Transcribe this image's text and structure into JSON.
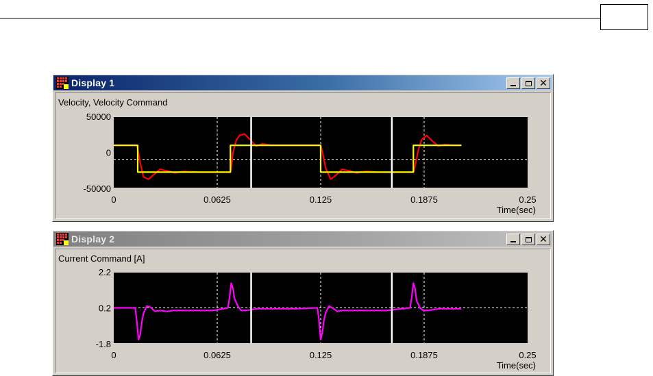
{
  "windows": [
    {
      "title": "Display 1",
      "active": true,
      "controls": {
        "minimize_icon": "minimize-icon",
        "maximize_icon": "maximize-icon",
        "close_icon": "close-icon"
      },
      "chart_data": {
        "type": "line",
        "title": "Velocity, Velocity Command",
        "xlabel": "Time(sec)",
        "ylabel": "",
        "xlim": [
          0,
          0.25
        ],
        "ylim": [
          -50000,
          50000
        ],
        "x_ticks": [
          "0",
          "0.0625",
          "0.125",
          "0.1875",
          "0.25"
        ],
        "y_ticks": [
          "50000",
          "0",
          "-50000"
        ],
        "y_tick_values": [
          50000,
          0,
          -50000
        ],
        "grid": true,
        "grid_values": {
          "x": [
            0.0625,
            0.125,
            0.1875
          ],
          "y": [
            -10000
          ]
        },
        "cursor_lines": [
          0.083,
          0.168
        ],
        "series": [
          {
            "color": "#ff0000",
            "x": [
              0,
              0.014,
              0.0145,
              0.016,
              0.018,
              0.021,
              0.024,
              0.028,
              0.032,
              0.037,
              0.042,
              0.05,
              0.06,
              0.0705,
              0.071,
              0.072,
              0.074,
              0.076,
              0.079,
              0.082,
              0.086,
              0.09,
              0.095,
              0.1,
              0.11,
              0.12,
              0.125,
              0.126,
              0.128,
              0.131,
              0.134,
              0.138,
              0.142,
              0.147,
              0.152,
              0.16,
              0.17,
              0.181,
              0.182,
              0.184,
              0.186,
              0.189,
              0.192,
              0.196,
              0.2,
              0.205,
              0.21
            ],
            "y": [
              10000,
              10000,
              5000,
              -15000,
              -35000,
              -38000,
              -32000,
              -24000,
              -26000,
              -29000,
              -27000,
              -28000,
              -28000,
              -28000,
              -22000,
              0,
              17000,
              24000,
              26000,
              19000,
              9000,
              12000,
              10000,
              10000,
              10000,
              10000,
              10000,
              2000,
              -22000,
              -38000,
              -33000,
              -24000,
              -26000,
              -29000,
              -27000,
              -28000,
              -28000,
              -28000,
              -20000,
              3000,
              18000,
              24000,
              17000,
              9000,
              11000,
              10000,
              10000
            ]
          },
          {
            "color": "#ffff00",
            "x": [
              0,
              0.0145,
              0.0145,
              0.0705,
              0.0705,
              0.125,
              0.125,
              0.181,
              0.181,
              0.21
            ],
            "y": [
              10000,
              10000,
              -28000,
              -28000,
              10000,
              10000,
              -28000,
              -28000,
              10000,
              10000
            ]
          }
        ]
      }
    },
    {
      "title": "Display 2",
      "active": false,
      "controls": {
        "minimize_icon": "minimize-icon",
        "maximize_icon": "maximize-icon",
        "close_icon": "close-icon"
      },
      "chart_data": {
        "type": "line",
        "title": "Current Command [A]",
        "xlabel": "Time(sec)",
        "ylabel": "",
        "xlim": [
          0,
          0.25
        ],
        "ylim": [
          -1.8,
          2.2
        ],
        "x_ticks": [
          "0",
          "0.0625",
          "0.125",
          "0.1875",
          "0.25"
        ],
        "y_ticks": [
          "2.2",
          "0.2",
          "-1.8"
        ],
        "y_tick_values": [
          2.2,
          0.2,
          -1.8
        ],
        "grid": true,
        "grid_values": {
          "x": [
            0.0625,
            0.125,
            0.1875
          ],
          "y": [
            0.2
          ]
        },
        "cursor_lines": [
          0.083,
          0.168
        ],
        "series": [
          {
            "color": "#ff00ff",
            "x": [
              0,
              0.013,
              0.014,
              0.015,
              0.016,
              0.017,
              0.018,
              0.02,
              0.022,
              0.025,
              0.028,
              0.032,
              0.036,
              0.04,
              0.05,
              0.06,
              0.069,
              0.07,
              0.071,
              0.072,
              0.073,
              0.075,
              0.077,
              0.08,
              0.083,
              0.087,
              0.092,
              0.1,
              0.11,
              0.123,
              0.124,
              0.125,
              0.126,
              0.127,
              0.128,
              0.13,
              0.132,
              0.135,
              0.138,
              0.142,
              0.148,
              0.155,
              0.165,
              0.179,
              0.18,
              0.181,
              0.182,
              0.183,
              0.185,
              0.187,
              0.19,
              0.193,
              0.197,
              0.202,
              0.21
            ],
            "y": [
              0.2,
              0.2,
              -0.6,
              -1.6,
              -1.3,
              -0.6,
              -0.1,
              0.3,
              0.25,
              0.0,
              0.05,
              0.0,
              0.05,
              0.05,
              0.05,
              0.05,
              0.2,
              0.8,
              1.6,
              1.3,
              0.7,
              0.3,
              0.05,
              0.05,
              0.1,
              0.15,
              0.15,
              0.15,
              0.15,
              0.2,
              -0.5,
              -1.6,
              -1.2,
              -0.5,
              -0.1,
              0.3,
              0.2,
              0.0,
              0.05,
              0.05,
              0.05,
              0.05,
              0.05,
              0.2,
              0.8,
              1.6,
              1.3,
              0.6,
              0.2,
              0.05,
              0.05,
              0.1,
              0.15,
              0.15,
              0.15
            ]
          }
        ]
      }
    }
  ],
  "icons": {
    "app": "display-app-icon"
  }
}
